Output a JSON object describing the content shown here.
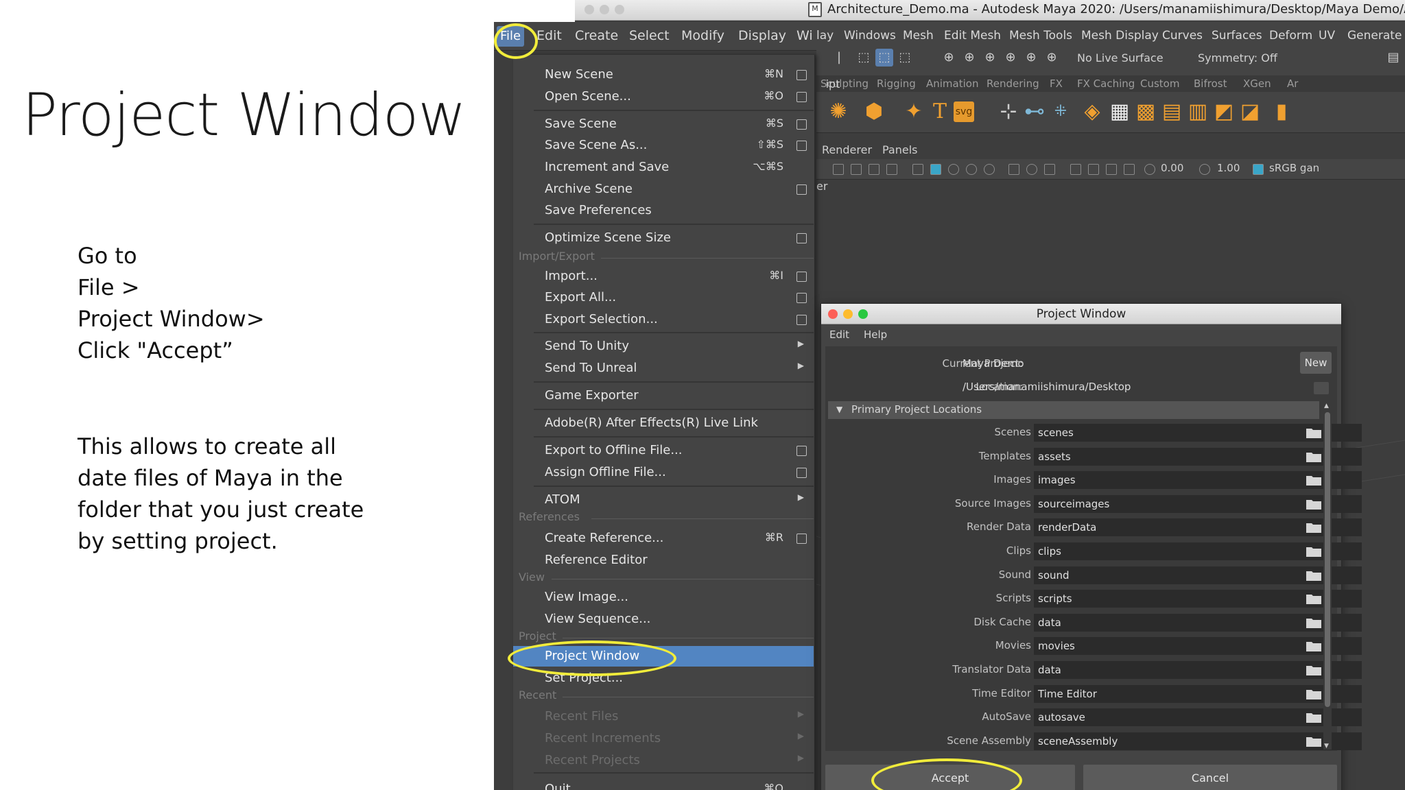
{
  "slide": {
    "title": "Project Window",
    "steps": [
      "Go to",
      "File >",
      "Project Window>",
      "Click \"Accept”"
    ],
    "note": [
      "This allows to create all",
      "date files of Maya in the",
      "folder that you just create",
      "by setting project."
    ]
  },
  "window": {
    "title": "Architecture_Demo.ma - Autodesk Maya 2020: /Users/manamiishimura/Desktop/Maya Demo/Arc"
  },
  "menubar": {
    "file": "File",
    "main_items": [
      "Edit",
      "Create",
      "Select",
      "Modify",
      "Display",
      "Wi"
    ],
    "right_items": [
      "lay",
      "Windows",
      "Mesh",
      "Edit Mesh",
      "Mesh Tools",
      "Mesh Display",
      "Curves",
      "Surfaces",
      "Deform",
      "UV",
      "Generate"
    ]
  },
  "toolbar": {
    "live_surface": "No Live Surface",
    "symmetry": "Symmetry: Off",
    "shelf_tabs": [
      "Sculpting",
      "Rigging",
      "Animation",
      "Rendering",
      "FX",
      "FX Caching",
      "Custom",
      "Bifrost",
      "XGen",
      "Ar"
    ],
    "side_label": "ipt",
    "panel_menu": [
      "Renderer",
      "Panels"
    ],
    "viewport_values": [
      "0.00",
      "1.00",
      "sRGB gan"
    ],
    "clip_label": "er"
  },
  "file_menu": {
    "items": [
      {
        "label": "New Scene",
        "shortcut": "⌘N",
        "box": true
      },
      {
        "label": "Open Scene...",
        "shortcut": "⌘O",
        "box": true
      },
      {
        "label": "Save Scene",
        "shortcut": "⌘S",
        "box": true
      },
      {
        "label": "Save Scene As...",
        "shortcut": "⇧⌘S",
        "box": true
      },
      {
        "label": "Increment and Save",
        "shortcut": "⌥⌘S",
        "box": false
      },
      {
        "label": "Archive Scene",
        "shortcut": "",
        "box": true
      },
      {
        "label": "Save Preferences",
        "shortcut": "",
        "box": false
      },
      {
        "label": "Optimize Scene Size",
        "shortcut": "",
        "box": true
      },
      {
        "label": "Import...",
        "shortcut": "⌘I",
        "box": true
      },
      {
        "label": "Export All...",
        "shortcut": "",
        "box": true
      },
      {
        "label": "Export Selection...",
        "shortcut": "",
        "box": true
      },
      {
        "label": "Send To Unity",
        "shortcut": "",
        "box": false
      },
      {
        "label": "Send To Unreal",
        "shortcut": "",
        "box": false
      },
      {
        "label": "Game Exporter",
        "shortcut": "",
        "box": false
      },
      {
        "label": "Adobe(R) After Effects(R) Live Link",
        "shortcut": "",
        "box": false
      },
      {
        "label": "Export to Offline File...",
        "shortcut": "",
        "box": true
      },
      {
        "label": "Assign Offline File...",
        "shortcut": "",
        "box": true
      },
      {
        "label": "ATOM",
        "shortcut": "",
        "box": false
      },
      {
        "label": "Create Reference...",
        "shortcut": "⌘R",
        "box": true
      },
      {
        "label": "Reference Editor",
        "shortcut": "",
        "box": false
      },
      {
        "label": "View Image...",
        "shortcut": "",
        "box": false
      },
      {
        "label": "View Sequence...",
        "shortcut": "",
        "box": false
      },
      {
        "label": "Project Window",
        "shortcut": "",
        "box": false
      },
      {
        "label": "Set Project...",
        "shortcut": "",
        "box": false
      },
      {
        "label": "Recent Files",
        "shortcut": "",
        "box": false
      },
      {
        "label": "Recent Increments",
        "shortcut": "",
        "box": false
      },
      {
        "label": "Recent Projects",
        "shortcut": "",
        "box": false
      },
      {
        "label": "Quit",
        "shortcut": "⌘Q",
        "box": false
      }
    ],
    "sections": [
      "Import/Export",
      "References",
      "View",
      "Project",
      "Recent"
    ]
  },
  "project_window": {
    "title": "Project Window",
    "menu": [
      "Edit",
      "Help"
    ],
    "current_project_label": "Current Project:",
    "current_project": "Maya Demo",
    "new_button": "New",
    "location_label": "Location:",
    "location": "/Users/manamiishimura/Desktop",
    "section": "Primary Project Locations",
    "locations": [
      {
        "label": "Scenes",
        "value": "scenes"
      },
      {
        "label": "Templates",
        "value": "assets"
      },
      {
        "label": "Images",
        "value": "images"
      },
      {
        "label": "Source Images",
        "value": "sourceimages"
      },
      {
        "label": "Render Data",
        "value": "renderData"
      },
      {
        "label": "Clips",
        "value": "clips"
      },
      {
        "label": "Sound",
        "value": "sound"
      },
      {
        "label": "Scripts",
        "value": "scripts"
      },
      {
        "label": "Disk Cache",
        "value": "data"
      },
      {
        "label": "Movies",
        "value": "movies"
      },
      {
        "label": "Translator Data",
        "value": "data"
      },
      {
        "label": "Time Editor",
        "value": "Time Editor"
      },
      {
        "label": "AutoSave",
        "value": "autosave"
      },
      {
        "label": "Scene Assembly",
        "value": "sceneAssembly"
      }
    ],
    "accept_button": "Accept",
    "cancel_button": "Cancel"
  },
  "colors": {
    "highlight": "#5285c2",
    "annotation": "#f1ec3b",
    "ui_bg": "#444444",
    "shelf_accent": "#f0a030"
  }
}
